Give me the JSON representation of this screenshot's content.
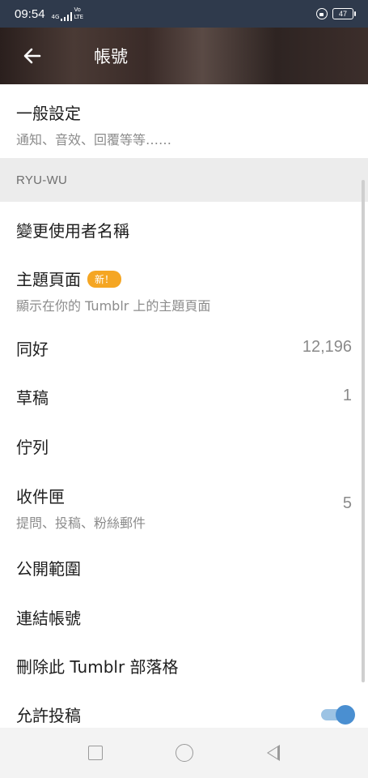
{
  "status_bar": {
    "time": "09:54",
    "network_top": "4G",
    "network_volte": "Vo\nLTE",
    "battery": "47"
  },
  "header": {
    "title": "帳號",
    "back_icon": "arrow-left-icon"
  },
  "general": {
    "title": "一般設定",
    "subtitle": "通知、音效、回覆等等……"
  },
  "section": {
    "name": "RYU-WU"
  },
  "items": {
    "change_username": {
      "title": "變更使用者名稱"
    },
    "theme_page": {
      "title": "主題頁面",
      "badge": "新！",
      "subtitle": "顯示在你的 Tumblr 上的主題頁面"
    },
    "followers": {
      "title": "同好",
      "value": "12,196"
    },
    "drafts": {
      "title": "草稿",
      "value": "1"
    },
    "queue": {
      "title": "佇列"
    },
    "inbox": {
      "title": "收件匣",
      "subtitle": "提問、投稿、粉絲郵件",
      "value": "5"
    },
    "visibility": {
      "title": "公開範圍"
    },
    "linked_accounts": {
      "title": "連結帳號"
    },
    "delete_blog": {
      "title": "刪除此 Tumblr 部落格"
    },
    "allow_submissions": {
      "title": "允許投稿",
      "enabled": true
    }
  },
  "colors": {
    "badge": "#f5a623",
    "toggle_on": "#4a8fd1"
  }
}
